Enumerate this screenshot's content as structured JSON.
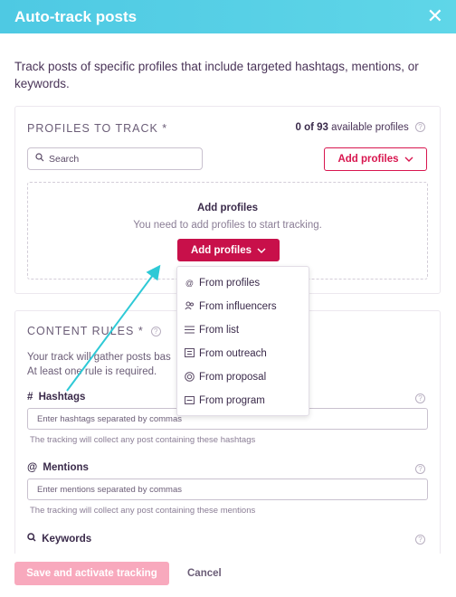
{
  "header": {
    "title": "Auto-track posts",
    "close_glyph": "✕"
  },
  "intro": "Track posts of specific profiles that include targeted hashtags, mentions, or keywords.",
  "profiles_section": {
    "title": "PROFILES TO TRACK *",
    "available_count": "0 of 93",
    "available_suffix": "available profiles",
    "search_placeholder": "Search",
    "add_button": "Add profiles",
    "empty_title": "Add profiles",
    "empty_subtitle": "You need to add profiles to start tracking.",
    "empty_button": "Add profiles"
  },
  "dropdown": {
    "items": [
      {
        "label": "From profiles",
        "icon": "at-icon"
      },
      {
        "label": "From influencers",
        "icon": "users-icon"
      },
      {
        "label": "From list",
        "icon": "list-icon"
      },
      {
        "label": "From outreach",
        "icon": "outreach-icon"
      },
      {
        "label": "From proposal",
        "icon": "proposal-icon"
      },
      {
        "label": "From program",
        "icon": "program-icon"
      }
    ]
  },
  "rules_section": {
    "title": "CONTENT RULES *",
    "desc_line1": "Your track will gather posts bas",
    "desc_line2": "At least one rule is required.",
    "hashtags": {
      "label": "Hashtags",
      "placeholder": "Enter hashtags separated by commas",
      "note": "The tracking will collect any post containing these hashtags"
    },
    "mentions": {
      "label": "Mentions",
      "placeholder": "Enter mentions separated by commas",
      "note": "The tracking will collect any post containing these mentions"
    },
    "keywords": {
      "label": "Keywords"
    }
  },
  "footer": {
    "primary": "Save and activate tracking",
    "cancel": "Cancel"
  },
  "colors": {
    "accent": "#d8164f",
    "header": "#4ec9e3",
    "arrow": "#2ec9d6"
  }
}
